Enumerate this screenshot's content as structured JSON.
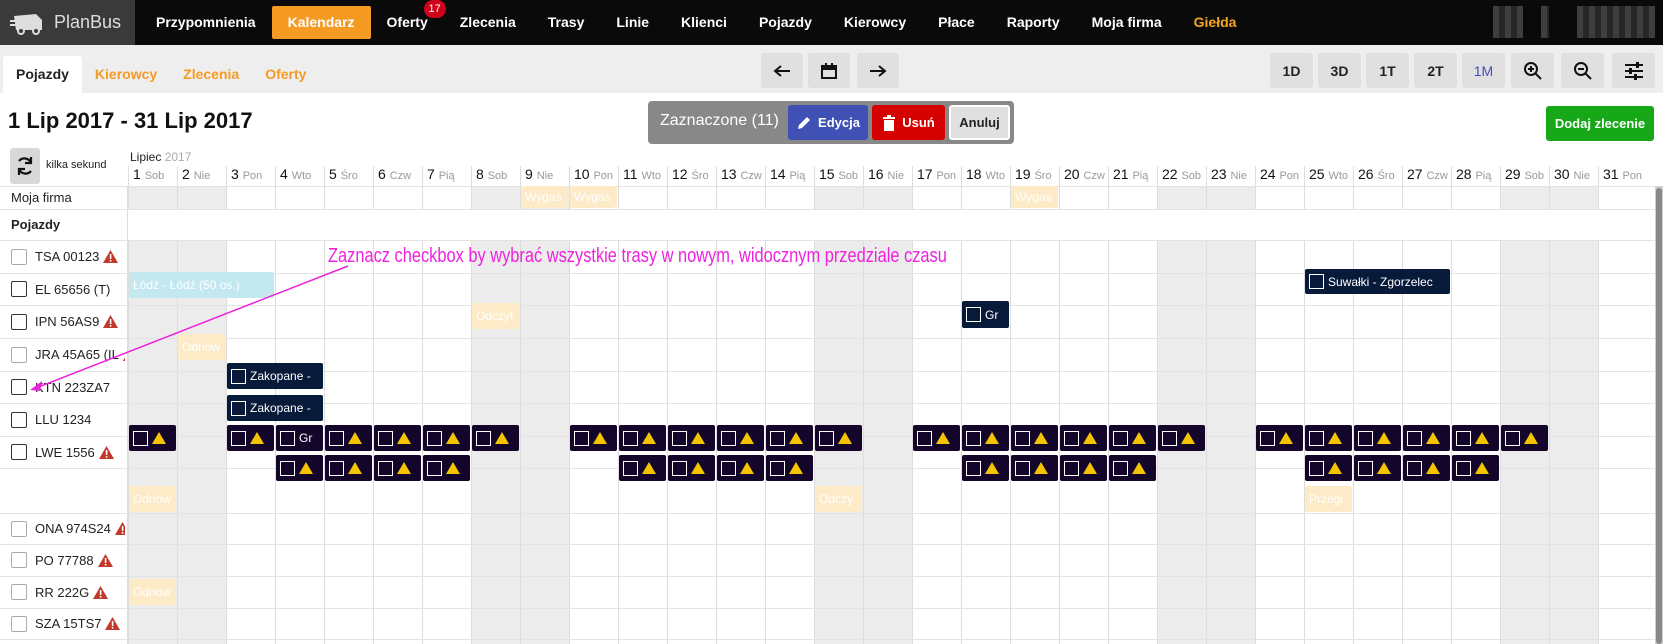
{
  "app": {
    "name": "PlanBus"
  },
  "nav": {
    "items": [
      {
        "label": "Przypomnienia"
      },
      {
        "label": "Kalendarz",
        "active": true
      },
      {
        "label": "Oferty",
        "badge": "17"
      },
      {
        "label": "Zlecenia"
      },
      {
        "label": "Trasy"
      },
      {
        "label": "Linie"
      },
      {
        "label": "Klienci"
      },
      {
        "label": "Pojazdy"
      },
      {
        "label": "Kierowcy"
      },
      {
        "label": "Płace"
      },
      {
        "label": "Raporty"
      },
      {
        "label": "Moja firma"
      },
      {
        "label": "Giełda",
        "highlight": true
      }
    ]
  },
  "subtabs": [
    {
      "label": "Pojazdy",
      "active": true
    },
    {
      "label": "Kierowcy"
    },
    {
      "label": "Zlecenia"
    },
    {
      "label": "Oferty"
    }
  ],
  "toolbar": {
    "prev_icon": "arrow-left-icon",
    "calendar_icon": "calendar-icon",
    "next_icon": "arrow-right-icon",
    "views": [
      "1D",
      "3D",
      "1T",
      "2T",
      "1M"
    ],
    "active_view": "1M",
    "zoom_in_icon": "zoom-in-icon",
    "zoom_out_icon": "zoom-out-icon",
    "settings_icon": "sliders-icon"
  },
  "header": {
    "date_range": "1 Lip 2017 - 31 Lip 2017",
    "selection_label": "Zaznaczone (11)",
    "edit_label": "Edycja",
    "delete_label": "Usuń",
    "cancel_label": "Anuluj",
    "add_order_label": "Dodaj zlecenie",
    "refresh_label": "kilka sekund",
    "month": "Lipiec",
    "year": "2017"
  },
  "colors": {
    "accent": "#f59a23",
    "edit": "#3f51b5",
    "delete": "#d50000",
    "add": "#16a816",
    "annotation": "#ee22dd"
  },
  "days": [
    {
      "n": "1",
      "d": "Sob"
    },
    {
      "n": "2",
      "d": "Nie"
    },
    {
      "n": "3",
      "d": "Pon"
    },
    {
      "n": "4",
      "d": "Wto"
    },
    {
      "n": "5",
      "d": "Śro"
    },
    {
      "n": "6",
      "d": "Czw"
    },
    {
      "n": "7",
      "d": "Pią"
    },
    {
      "n": "8",
      "d": "Sob"
    },
    {
      "n": "9",
      "d": "Nie"
    },
    {
      "n": "10",
      "d": "Pon"
    },
    {
      "n": "11",
      "d": "Wto"
    },
    {
      "n": "12",
      "d": "Śro"
    },
    {
      "n": "13",
      "d": "Czw"
    },
    {
      "n": "14",
      "d": "Pią"
    },
    {
      "n": "15",
      "d": "Sob"
    },
    {
      "n": "16",
      "d": "Nie"
    },
    {
      "n": "17",
      "d": "Pon"
    },
    {
      "n": "18",
      "d": "Wto"
    },
    {
      "n": "19",
      "d": "Śro"
    },
    {
      "n": "20",
      "d": "Czw"
    },
    {
      "n": "21",
      "d": "Pią"
    },
    {
      "n": "22",
      "d": "Sob"
    },
    {
      "n": "23",
      "d": "Nie"
    },
    {
      "n": "24",
      "d": "Pon"
    },
    {
      "n": "25",
      "d": "Wto"
    },
    {
      "n": "26",
      "d": "Śro"
    },
    {
      "n": "27",
      "d": "Czw"
    },
    {
      "n": "28",
      "d": "Pią"
    },
    {
      "n": "29",
      "d": "Sob"
    },
    {
      "n": "30",
      "d": "Nie"
    },
    {
      "n": "31",
      "d": "Pon"
    }
  ],
  "rows": {
    "company": "Moja firma",
    "section": "Pojazdy",
    "vehicles": [
      {
        "name": "TSA 00123",
        "warn": true
      },
      {
        "name": "EL 65656 (T)",
        "warn": false
      },
      {
        "name": "IPN 56AS9",
        "warn": true
      },
      {
        "name": "JRA 45A65 (IL",
        "warn": true
      },
      {
        "name": "KTN 223ZA7",
        "warn": false
      },
      {
        "name": "LLU 1234",
        "warn": false
      },
      {
        "name": "LWE 1556",
        "warn": true
      },
      {
        "name": "ONA 974S24",
        "warn": true
      },
      {
        "name": "PO 77788",
        "warn": true
      },
      {
        "name": "RR 222G",
        "warn": true
      },
      {
        "name": "SZA 15TS7",
        "warn": true
      }
    ]
  },
  "events": {
    "company": [
      {
        "text": "Wygas",
        "day": 9
      },
      {
        "text": "Wygas",
        "day": 10
      },
      {
        "text": "Wygas",
        "day": 19
      }
    ],
    "el": {
      "text": "Łódź - Łódź (50 os.)"
    },
    "el2": {
      "text": "Suwałki - Zgorzelec"
    },
    "ipn1": {
      "text": "Odczyt"
    },
    "ipn2": {
      "text": "Gr"
    },
    "jra": {
      "text": "Odnow"
    },
    "ktn": {
      "text": "Zakopane -"
    },
    "llu": {
      "text": "Zakopane -"
    },
    "lwe": {
      "text": "Gr"
    },
    "ona1": {
      "text": "Odnow"
    },
    "ona2": {
      "text": "Odczy"
    },
    "ona3": {
      "text": "Przegl"
    },
    "sza": {
      "text": "Odnow"
    }
  },
  "annotation": "Zaznacz checkbox by wybrać wszystkie trasy w nowym, widocznym przedziale czasu"
}
